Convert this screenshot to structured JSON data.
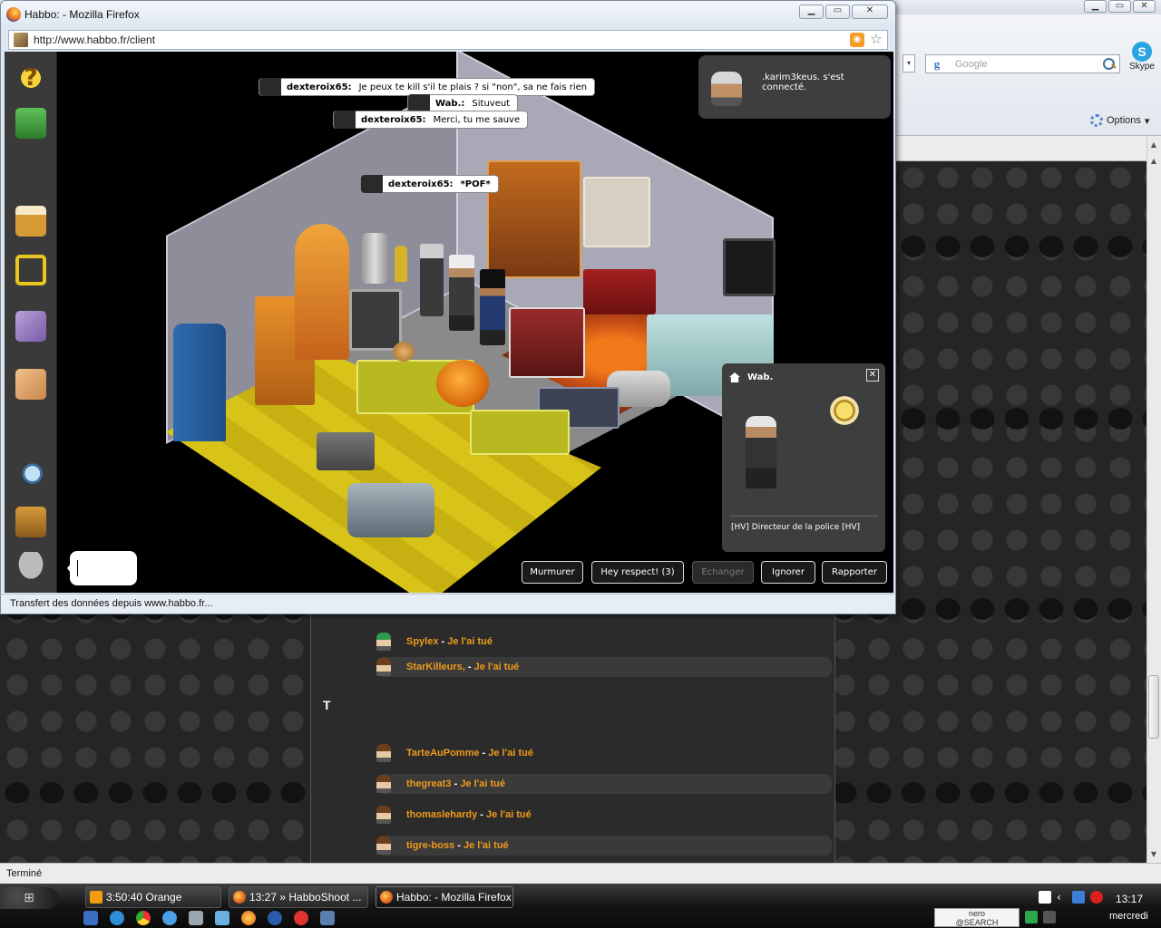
{
  "background_browser": {
    "search_placeholder": "Google",
    "skype_label": "Skype",
    "options_label": "Options",
    "status_text": "Terminé"
  },
  "list": {
    "letter": "T",
    "rows": [
      {
        "name": "Spylex",
        "action": "Je l'ai tué"
      },
      {
        "name": "StarKilleurs,",
        "action": "Je l'ai tué"
      },
      {
        "name": "TarteAuPomme",
        "action": "Je l'ai tué"
      },
      {
        "name": "thegreat3",
        "action": "Je l'ai tué"
      },
      {
        "name": "thomaslehardy",
        "action": "Je l'ai tué"
      },
      {
        "name": "tigre-boss",
        "action": "Je l'ai tué"
      }
    ],
    "separator": " - "
  },
  "popup": {
    "title": "Habbo: - Mozilla Firefox",
    "url": "http://www.habbo.fr/client",
    "status": "Transfert des données depuis www.habbo.fr..."
  },
  "chat": [
    {
      "name": "dexteroix65:",
      "text": "Je peux te kill s'il te plais ? si \"non\", sa ne fais rien"
    },
    {
      "name": "Wab.:",
      "text": "Situveut"
    },
    {
      "name": "dexteroix65:",
      "text": "Merci, tu me sauve"
    },
    {
      "name": "dexteroix65:",
      "text": "*POF*"
    }
  ],
  "notification": {
    "text": ".karim3keus. s'est connecté."
  },
  "user_card": {
    "name": "Wab.",
    "motto": "[HV] Directeur de la police [HV]"
  },
  "actions": {
    "whisper": "Murmurer",
    "respect": "Hey respect! (3)",
    "trade": "Echanger",
    "ignore": "Ignorer",
    "report": "Rapporter"
  },
  "taskbar": {
    "tasks": [
      "3:50:40 Orange",
      "13:27 » HabboShoot ...",
      "Habbo: - Mozilla Firefox"
    ],
    "nero": "nero\n@SEARCH",
    "time": "13:17",
    "day": "mercredi"
  },
  "colors": {
    "link_orange": "#f09a1c",
    "game_bg": "#000000",
    "panel_dark": "#3e3e3e"
  }
}
